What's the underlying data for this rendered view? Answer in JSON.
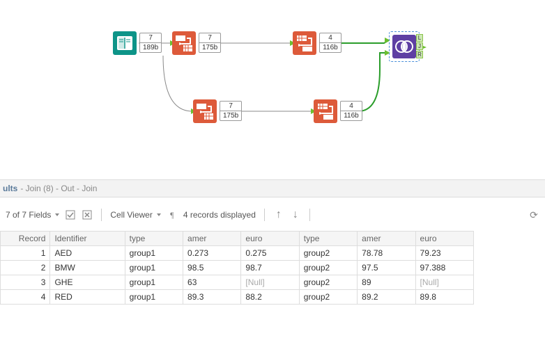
{
  "canvas": {
    "nodes": [
      {
        "id": "box1",
        "top": "189b",
        "top2": "7"
      },
      {
        "id": "box2",
        "top": "175b",
        "top2": "7"
      },
      {
        "id": "box3",
        "top": "116b",
        "top2": "4"
      },
      {
        "id": "box4",
        "top": "175b",
        "top2": "7"
      },
      {
        "id": "box5",
        "top": "116b",
        "top2": "4"
      }
    ],
    "join_labels": {
      "l": "L",
      "j": "J",
      "r": "R"
    }
  },
  "results": {
    "header_label": "ults",
    "header_detail": " - Join (8) - Out - Join",
    "fields_dd": "7 of 7 Fields",
    "cellviewer": "Cell Viewer",
    "records_text": "4 records displayed",
    "columns": [
      "Record",
      "Identifier",
      "type",
      "amer",
      "euro",
      "type",
      "amer",
      "euro"
    ],
    "rows": [
      {
        "rec": "1",
        "id": "AED",
        "t1": "group1",
        "a1": "0.273",
        "e1": "0.275",
        "t2": "group2",
        "a2": "78.78",
        "e2": "79.23"
      },
      {
        "rec": "2",
        "id": "BMW",
        "t1": "group1",
        "a1": "98.5",
        "e1": "98.7",
        "t2": "group2",
        "a2": "97.5",
        "e2": "97.388"
      },
      {
        "rec": "3",
        "id": "GHE",
        "t1": "group1",
        "a1": "63",
        "e1": "[Null]",
        "t2": "group2",
        "a2": "89",
        "e2": "[Null]"
      },
      {
        "rec": "4",
        "id": "RED",
        "t1": "group1",
        "a1": "89.3",
        "e1": "88.2",
        "t2": "group2",
        "a2": "89.2",
        "e2": "89.8"
      }
    ]
  }
}
